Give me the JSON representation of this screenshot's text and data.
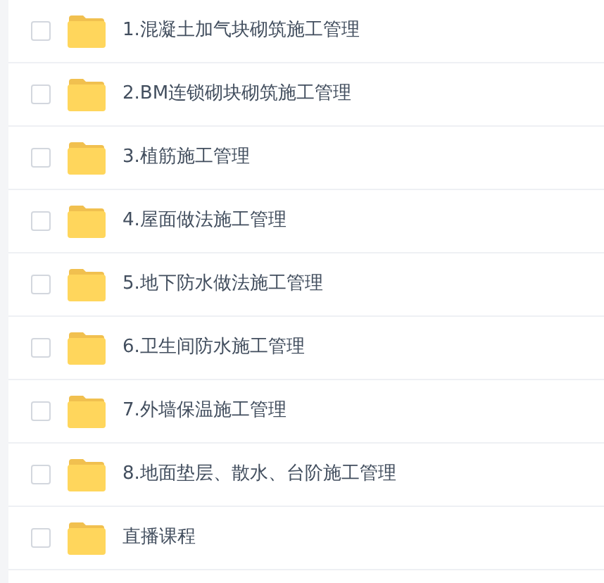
{
  "items": [
    {
      "name": "1.混凝土加气块砌筑施工管理",
      "checked": false
    },
    {
      "name": "2.BM连锁砌块砌筑施工管理",
      "checked": false
    },
    {
      "name": "3.植筋施工管理",
      "checked": false
    },
    {
      "name": "4.屋面做法施工管理",
      "checked": false
    },
    {
      "name": "5.地下防水做法施工管理",
      "checked": false
    },
    {
      "name": "6.卫生间防水施工管理",
      "checked": false
    },
    {
      "name": "7.外墙保温施工管理",
      "checked": false
    },
    {
      "name": "8.地面垫层、散水、台阶施工管理",
      "checked": false
    },
    {
      "name": "直播课程",
      "checked": false
    }
  ]
}
